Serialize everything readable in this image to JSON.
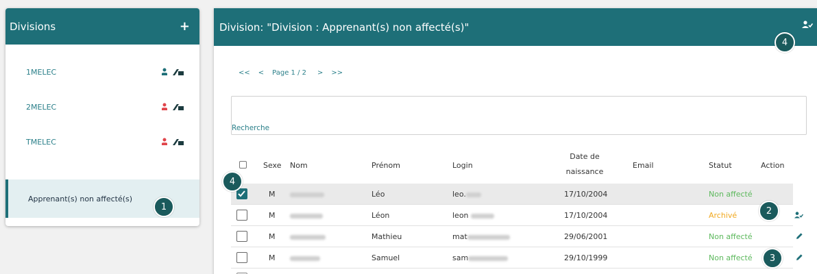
{
  "left": {
    "title": "Divisions",
    "add_label": "+",
    "items": [
      {
        "label": "1MELEC",
        "person_icon_color": "#1e6f78"
      },
      {
        "label": "2MELEC",
        "person_icon_color": "#e0454b"
      },
      {
        "label": "TMELEC",
        "person_icon_color": "#e0454b"
      },
      {
        "label": "Apprenant(s) non affecté(s)"
      }
    ]
  },
  "right": {
    "title": "Division: \"Division : Apprenant(s) non affecté(s)\""
  },
  "pager": {
    "first": "<<",
    "prev": "<",
    "label": "Page 1 / 2",
    "next": ">",
    "last": ">>"
  },
  "search": {
    "label": "Recherche"
  },
  "table": {
    "headers": {
      "sexe": "Sexe",
      "nom": "Nom",
      "prenom": "Prénom",
      "login": "Login",
      "dob_line1": "Date de",
      "dob_line2": "naissance",
      "email": "Email",
      "statut": "Statut",
      "action": "Action"
    },
    "rows": [
      {
        "sexe": "M",
        "prenom": "Léo",
        "login": "leo.",
        "dob": "17/10/2004",
        "statut": "Non affecté",
        "status_color": "#5cb85c",
        "checked": true
      },
      {
        "sexe": "M",
        "prenom": "Léon",
        "login": "leon",
        "dob": "17/10/2004",
        "statut": "Archivé",
        "status_color": "#f0a81e",
        "checked": false
      },
      {
        "sexe": "M",
        "prenom": "Mathieu",
        "login": "mat",
        "dob": "29/06/2001",
        "statut": "Non affecté",
        "status_color": "#5cb85c",
        "checked": false
      },
      {
        "sexe": "M",
        "prenom": "Samuel",
        "login": "sam",
        "dob": "29/10/1999",
        "statut": "Non affecté",
        "status_color": "#5cb85c",
        "checked": false
      }
    ]
  },
  "badges": {
    "b1": "1",
    "b2": "2",
    "b3": "3",
    "b4a": "4",
    "b4b": "4"
  },
  "colors": {
    "accent": "#1e6f78",
    "badge": "#1a5a5c",
    "status_green": "#5cb85c",
    "status_orange": "#f0a81e"
  }
}
